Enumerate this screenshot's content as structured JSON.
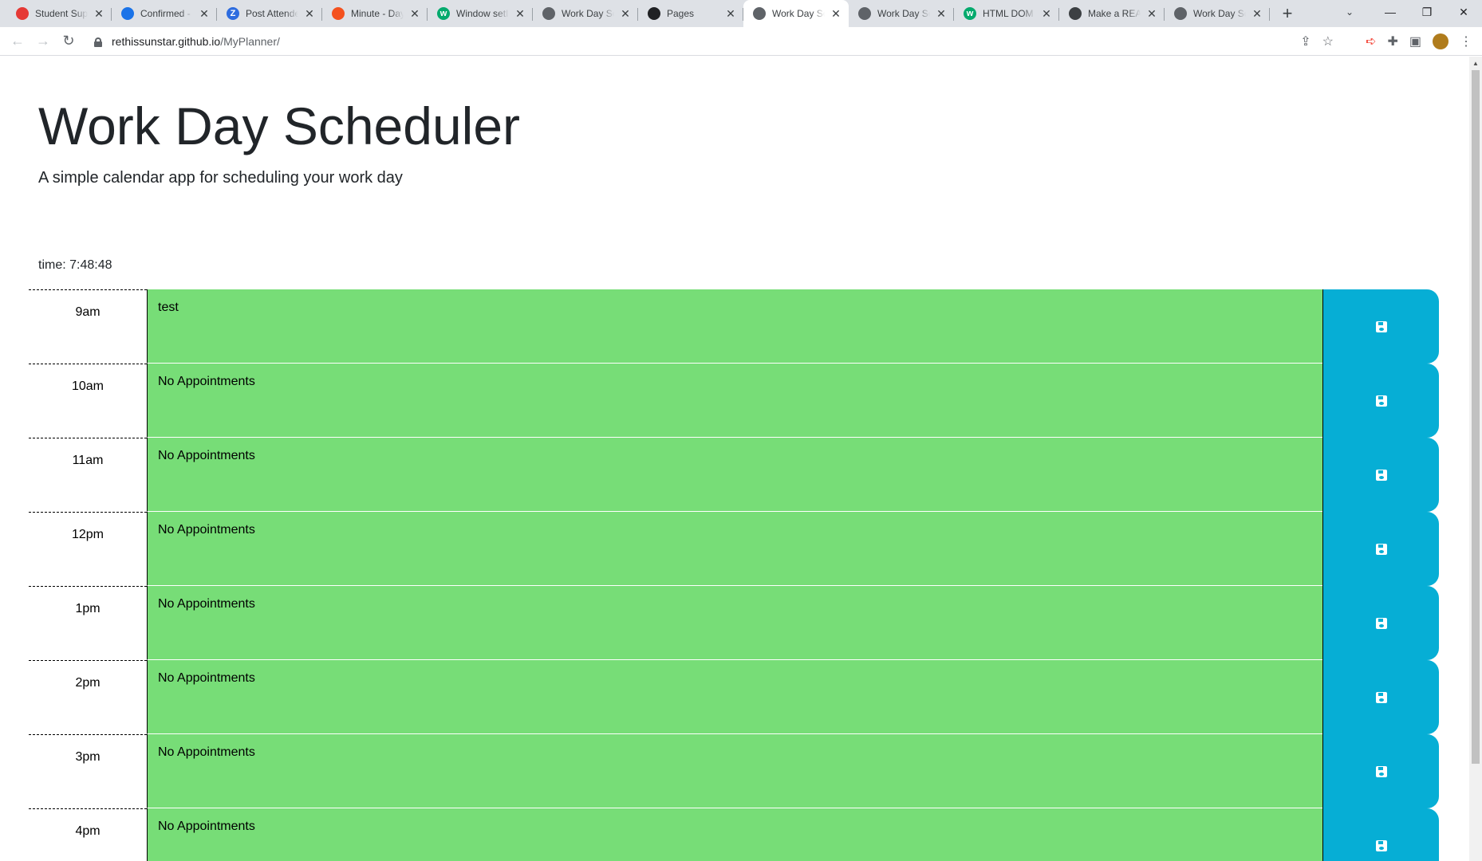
{
  "browser": {
    "tabs": [
      {
        "title": "Student Sup",
        "favicon_color": "#e53935",
        "favicon_glyph": ""
      },
      {
        "title": "Confirmed -",
        "favicon_color": "#1a73e8",
        "favicon_glyph": ""
      },
      {
        "title": "Post Attende",
        "favicon_color": "#2d6cdf",
        "favicon_glyph": "Z"
      },
      {
        "title": "Minute - Day",
        "favicon_color": "#f4511e",
        "favicon_glyph": ""
      },
      {
        "title": "Window setI",
        "favicon_color": "#04aa6d",
        "favicon_glyph": "w"
      },
      {
        "title": "Work Day Sc",
        "favicon_color": "#5f6368",
        "favicon_glyph": ""
      },
      {
        "title": "Pages",
        "favicon_color": "#202124",
        "favicon_glyph": ""
      },
      {
        "title": "Work Day Sc",
        "favicon_color": "#5f6368",
        "favicon_glyph": "",
        "active": true
      },
      {
        "title": "Work Day Sc",
        "favicon_color": "#5f6368",
        "favicon_glyph": ""
      },
      {
        "title": "HTML DOM",
        "favicon_color": "#04aa6d",
        "favicon_glyph": "w"
      },
      {
        "title": "Make a REAL",
        "favicon_color": "#3c4043",
        "favicon_glyph": ""
      },
      {
        "title": "Work Day Sc",
        "favicon_color": "#5f6368",
        "favicon_glyph": ""
      }
    ],
    "url_host": "rethissunstar.github.io",
    "url_path": "/MyPlanner/"
  },
  "page": {
    "title": "Work Day Scheduler",
    "lead": "A simple calendar app for scheduling your work day",
    "time_label": "time: 7:48:48"
  },
  "planner": {
    "hours": [
      {
        "hour": "9am",
        "text": "test"
      },
      {
        "hour": "10am",
        "text": "No Appointments"
      },
      {
        "hour": "11am",
        "text": "No Appointments"
      },
      {
        "hour": "12pm",
        "text": "No Appointments"
      },
      {
        "hour": "1pm",
        "text": "No Appointments"
      },
      {
        "hour": "2pm",
        "text": "No Appointments"
      },
      {
        "hour": "3pm",
        "text": "No Appointments"
      },
      {
        "hour": "4pm",
        "text": "No Appointments"
      }
    ],
    "status_color": "#77dd77",
    "save_color": "#06aed5"
  }
}
